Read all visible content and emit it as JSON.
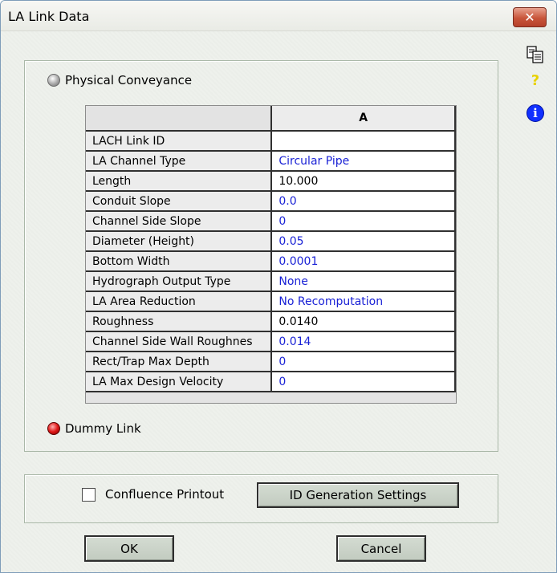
{
  "window": {
    "title": "LA Link Data",
    "close_symbol": "✕"
  },
  "side_icons": {
    "copy": "copy-icon",
    "help": "?",
    "info": "i"
  },
  "conveyance": {
    "physical_label": "Physical Conveyance",
    "dummy_label": "Dummy Link"
  },
  "grid": {
    "column_header": "A",
    "rows": [
      {
        "label": "LACH Link ID",
        "value": ""
      },
      {
        "label": "LA Channel Type",
        "value": "Circular Pipe"
      },
      {
        "label": "Length",
        "value": "10.000"
      },
      {
        "label": "Conduit Slope",
        "value": "0.0"
      },
      {
        "label": "Channel Side Slope",
        "value": "0"
      },
      {
        "label": "Diameter (Height)",
        "value": "0.05"
      },
      {
        "label": "Bottom Width",
        "value": "0.0001"
      },
      {
        "label": "Hydrograph Output Type",
        "value": "None"
      },
      {
        "label": "LA Area Reduction",
        "value": "No Recomputation"
      },
      {
        "label": "Roughness",
        "value": "0.0140"
      },
      {
        "label": "Channel Side Wall Roughnes",
        "value": "0.014"
      },
      {
        "label": "Rect/Trap Max Depth",
        "value": "0"
      },
      {
        "label": "LA Max Design Velocity",
        "value": "0"
      }
    ]
  },
  "options": {
    "confluence_label": "Confluence Printout",
    "confluence_checked": false,
    "id_generation_label": "ID Generation Settings"
  },
  "buttons": {
    "ok": "OK",
    "cancel": "Cancel"
  },
  "colors": {
    "value_text": "#1a22d6",
    "close_button": "#c8553a",
    "info_icon": "#1030ff"
  }
}
